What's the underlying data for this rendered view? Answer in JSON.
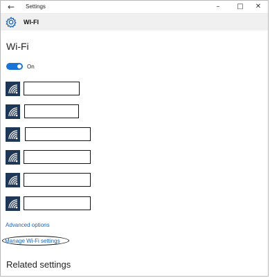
{
  "window": {
    "title": "Settings",
    "back_icon": "back-arrow-icon",
    "controls": [
      "minimize-icon",
      "maximize-icon",
      "close-icon"
    ]
  },
  "header": {
    "icon": "gear-icon",
    "title": "WI-FI"
  },
  "page": {
    "title": "Wi-Fi",
    "toggle": {
      "state": "on",
      "label": "On"
    },
    "networks": [
      {
        "icon": "wifi-signal-icon",
        "name": ""
      },
      {
        "icon": "wifi-signal-icon",
        "name": ""
      },
      {
        "icon": "wifi-signal-icon",
        "name": ""
      },
      {
        "icon": "wifi-signal-icon",
        "name": ""
      },
      {
        "icon": "wifi-signal-icon",
        "name": ""
      },
      {
        "icon": "wifi-signal-icon",
        "name": ""
      }
    ],
    "advanced_options": "Advanced options",
    "manage_wifi": "Manage Wi-Fi settings",
    "related_settings": "Related settings"
  },
  "colors": {
    "accent": "#1a73d6",
    "link": "#1a62b5",
    "tile": "#1f3756",
    "header_bg": "#f0f0f0"
  }
}
